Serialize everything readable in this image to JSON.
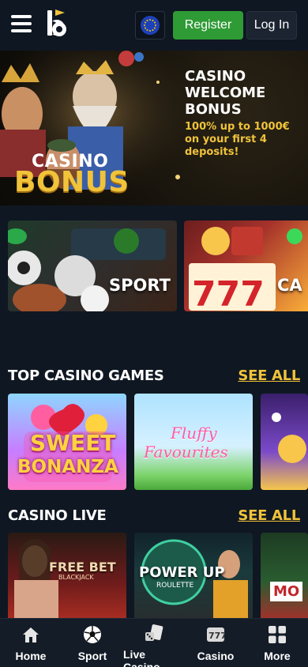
{
  "header": {
    "register_label": "Register",
    "login_label": "Log In"
  },
  "hero": {
    "title": "CASINO WELCOME BONUS",
    "subtitle": "100% up to 1000€ on your first 4 deposits!",
    "art_casino_word": "CASINO",
    "art_bonus_word": "BONUS"
  },
  "categories": [
    {
      "label": "SPORT"
    },
    {
      "label": "CA"
    }
  ],
  "sections": {
    "top_games": {
      "title": "TOP CASINO GAMES",
      "see_all": "SEE ALL"
    },
    "casino_live": {
      "title": "CASINO LIVE",
      "see_all": "SEE ALL"
    }
  },
  "top_games": [
    {
      "name": "Sweet Bonanza",
      "line1": "SWEET",
      "line2": "BONANZA"
    },
    {
      "name": "Fluffy Favourites",
      "line1": "Fluffy",
      "line2": "Favourites"
    },
    {
      "name": ""
    }
  ],
  "live_games": [
    {
      "line1": "FREE BET",
      "line2": "BLACKJACK"
    },
    {
      "line1": "POWER UP",
      "line2": "ROULETTE"
    },
    {
      "line1": "MO"
    }
  ],
  "bottom_nav": [
    {
      "label": "Home",
      "icon": "home-icon"
    },
    {
      "label": "Sport",
      "icon": "soccer-ball-icon"
    },
    {
      "label": "Live Casino",
      "icon": "cards-dice-icon"
    },
    {
      "label": "Casino",
      "icon": "slot-777-icon"
    },
    {
      "label": "More",
      "icon": "grid-icon"
    }
  ],
  "colors": {
    "background": "#0f1722",
    "accent_gold": "#f0c33a",
    "register_green": "#2e9b35",
    "nav_bg": "#141c27"
  }
}
